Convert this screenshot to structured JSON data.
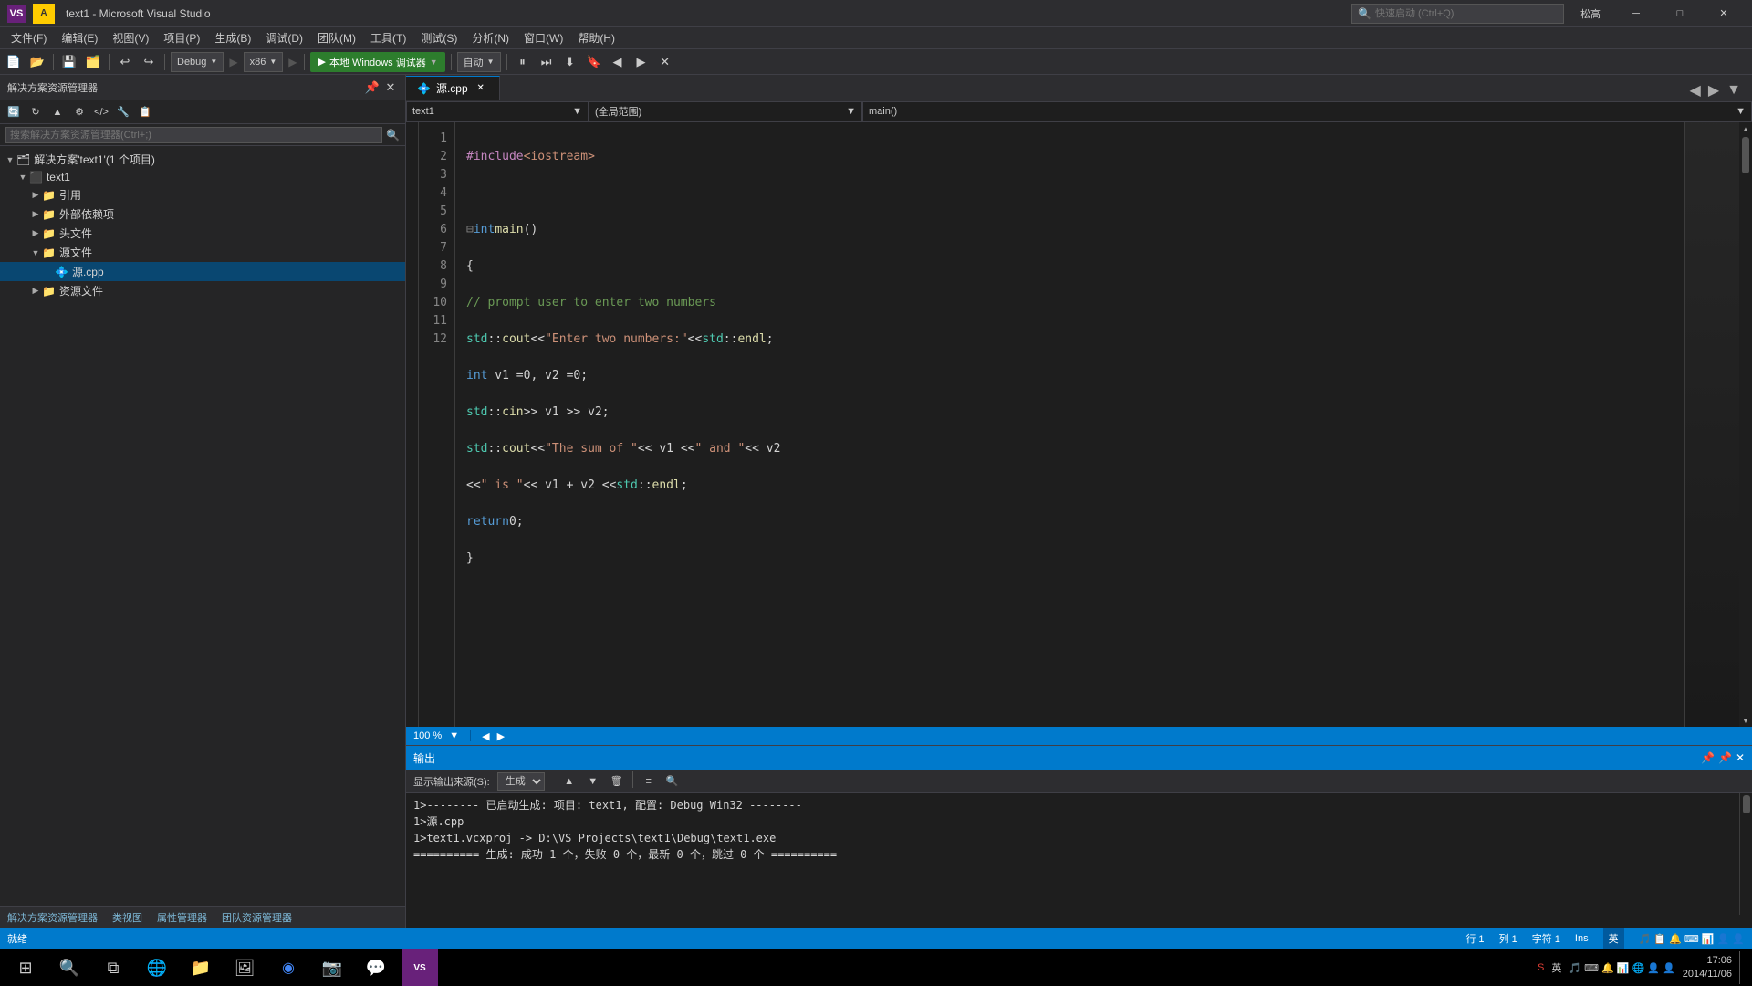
{
  "titleBar": {
    "title": "text1 - Microsoft Visual Studio",
    "searchPlaceholder": "快速启动 (Ctrl+Q)",
    "userName": "松高",
    "minimizeLabel": "─",
    "restoreLabel": "□",
    "closeLabel": "✕"
  },
  "menuBar": {
    "items": [
      "文件(F)",
      "编辑(E)",
      "视图(V)",
      "项目(P)",
      "生成(B)",
      "调试(D)",
      "团队(M)",
      "工具(T)",
      "测试(S)",
      "分析(N)",
      "窗口(W)",
      "帮助(H)"
    ]
  },
  "toolbar": {
    "debugMode": "Debug",
    "platform": "x86",
    "runLabel": "本地 Windows 调试器",
    "attachLabel": "自动"
  },
  "solutionExplorer": {
    "title": "解决方案资源管理器",
    "searchPlaceholder": "搜索解决方案资源管理器(Ctrl+;)",
    "solutionName": "解决方案'text1'(1 个项目)",
    "projectName": "text1",
    "nodes": [
      {
        "label": "引用",
        "level": 2,
        "icon": "📁",
        "expanded": false
      },
      {
        "label": "外部依赖项",
        "level": 2,
        "icon": "📁",
        "expanded": false
      },
      {
        "label": "头文件",
        "level": 2,
        "icon": "📁",
        "expanded": false
      },
      {
        "label": "源文件",
        "level": 2,
        "icon": "📁",
        "expanded": true
      },
      {
        "label": "源.cpp",
        "level": 3,
        "icon": "💠",
        "expanded": false,
        "active": true
      },
      {
        "label": "资源文件",
        "level": 2,
        "icon": "📁",
        "expanded": false
      }
    ],
    "bottomTabs": [
      "解决方案资源管理器",
      "类视图",
      "属性管理器",
      "团队资源管理器"
    ]
  },
  "editor": {
    "tabs": [
      {
        "label": "源.cpp",
        "active": true
      },
      {
        "label": "×",
        "isClose": true
      }
    ],
    "navDropdowns": [
      "text1",
      "(全局范围)",
      "main()"
    ],
    "zoomLevel": "100 %",
    "lines": [
      {
        "num": 1,
        "code": "#include <iostream>"
      },
      {
        "num": 2,
        "code": ""
      },
      {
        "num": 3,
        "code": "int main()"
      },
      {
        "num": 4,
        "code": "{"
      },
      {
        "num": 5,
        "code": "    // prompt user to enter two numbers"
      },
      {
        "num": 6,
        "code": "    std::cout << \"Enter two numbers:\" << std::endl;"
      },
      {
        "num": 7,
        "code": "    int v1 = 0, v2 = 0;"
      },
      {
        "num": 8,
        "code": "    std::cin >> v1 >> v2;"
      },
      {
        "num": 9,
        "code": "    std::cout << \"The sum of \" << v1 << \" and \" << v2"
      },
      {
        "num": 10,
        "code": "        << \" is \" << v1 + v2 << std::endl;"
      },
      {
        "num": 11,
        "code": "    return 0;"
      },
      {
        "num": 12,
        "code": "}"
      }
    ]
  },
  "output": {
    "title": "输出",
    "sourceLabel": "显示输出来源(S):",
    "sourceValue": "生成",
    "lines": [
      "1>-------- 已启动生成: 项目: text1, 配置: Debug Win32 --------",
      "1>源.cpp",
      "1>text1.vcxproj -> D:\\VS Projects\\text1\\Debug\\text1.exe",
      "========== 生成: 成功 1 个，失败 0 个，最新 0 个，跳过 0 个 =========="
    ]
  },
  "statusBar": {
    "status": "就绪",
    "row": "行 1",
    "col": "列 1",
    "char": "字符 1",
    "mode": "Ins"
  },
  "taskbar": {
    "time": "17:06",
    "date": "2014/11/06",
    "inputMethod": "英",
    "batteryIcon": "🔋"
  }
}
